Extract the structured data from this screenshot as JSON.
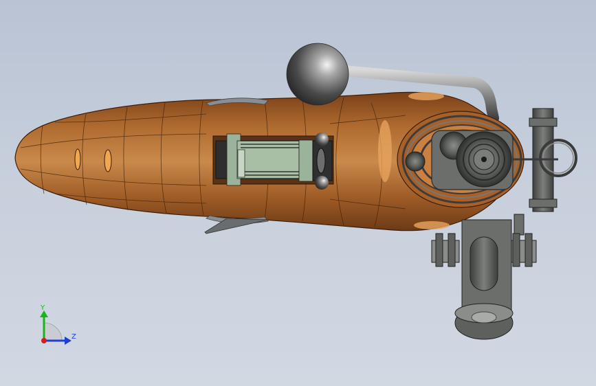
{
  "viewport": {
    "background_top": "#b9c3d4",
    "background_bottom": "#d2d8e2"
  },
  "triad": {
    "y_label": "Y",
    "z_label": "Z",
    "y_color": "#18b418",
    "z_color": "#1f3fd1",
    "x_color": "#d11f1f"
  },
  "model": {
    "body_color": "#a4622c",
    "metal_color": "#5f625f",
    "icons": [
      "bolt-knob-icon",
      "scope-ring-icon",
      "bipod-icon"
    ]
  }
}
